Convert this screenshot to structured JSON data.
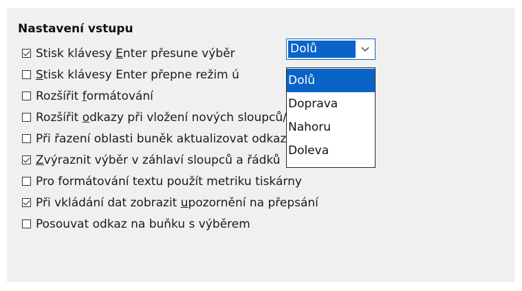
{
  "section": {
    "title": "Nastavení vstupu"
  },
  "options": [
    {
      "pre": "Stisk klávesy ",
      "ul": "E",
      "post": "nter přesune výběr",
      "checked": true
    },
    {
      "pre": "",
      "ul": "S",
      "post": "tisk klávesy Enter přepne režim ú",
      "checked": false
    },
    {
      "pre": "Rozšířit ",
      "ul": "f",
      "post": "ormátování",
      "checked": false
    },
    {
      "pre": "Rozšířit ",
      "ul": "o",
      "post": "dkazy při vložení nových sloupců/řádků",
      "checked": false
    },
    {
      "pre": "Při řazení oblasti buněk aktualizovat odkazy",
      "ul": "",
      "post": "",
      "checked": false
    },
    {
      "pre": "",
      "ul": "Z",
      "post": "výraznit výběr v záhlaví sloupců a řádků",
      "checked": true
    },
    {
      "pre": "Pro formátování textu použít metriku tiskárny",
      "ul": "",
      "post": "",
      "checked": false
    },
    {
      "pre": "Při vkládání dat zobrazit ",
      "ul": "u",
      "post": "pozornění na přepsání",
      "checked": true
    },
    {
      "pre": "Posouvat odkaz na buňku s výběrem",
      "ul": "",
      "post": "",
      "checked": false
    }
  ],
  "direction_combo": {
    "value": "Dolů",
    "options": [
      "Dolů",
      "Doprava",
      "Nahoru",
      "Doleva"
    ],
    "selected_index": 0
  },
  "colors": {
    "accent": "#0a64c8",
    "panel_bg": "#f0f0f0"
  }
}
